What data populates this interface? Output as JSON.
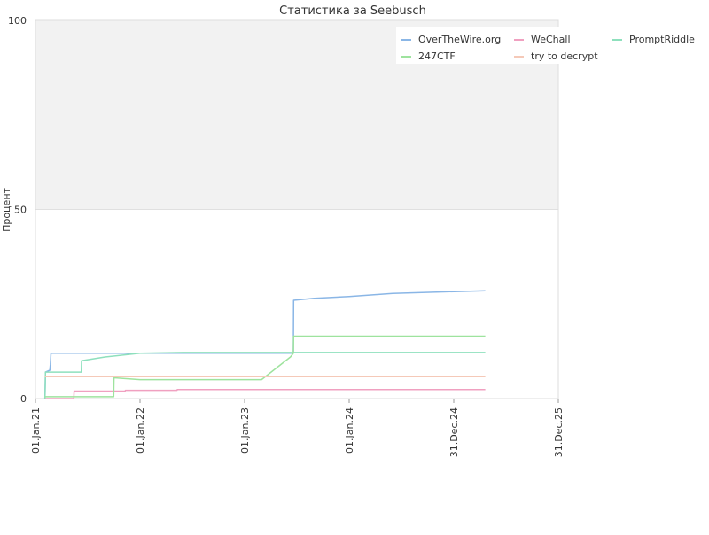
{
  "chart_data": {
    "type": "line",
    "title": "Статистика за Seebusch",
    "xlabel": "",
    "ylabel": "Процент",
    "xlim": [
      "2021-01-01",
      "2025-12-31"
    ],
    "ylim": [
      0,
      100
    ],
    "x_ticks": [
      "01.Jan.21",
      "01.Jan.22",
      "01.Jan.23",
      "01.Jan.24",
      "31.Dec.24",
      "31.Dec.25"
    ],
    "x_tick_dates": [
      "2021-01-01",
      "2022-01-01",
      "2023-01-01",
      "2024-01-01",
      "2024-12-31",
      "2025-12-31"
    ],
    "y_ticks": [
      "0",
      "50",
      "100"
    ],
    "y_tick_values": [
      0,
      50,
      100
    ],
    "grid": true,
    "band_color": "#f2f2f2",
    "legend_position": "top-right",
    "series": [
      {
        "name": "OverTheWire.org",
        "color": "#8ab6e6",
        "points": [
          [
            "2021-02-03",
            0
          ],
          [
            "2021-02-05",
            7
          ],
          [
            "2021-02-20",
            7.5
          ],
          [
            "2021-02-22",
            9
          ],
          [
            "2021-02-24",
            12
          ],
          [
            "2023-06-20",
            12
          ],
          [
            "2023-06-21",
            26
          ],
          [
            "2023-09-01",
            26.5
          ],
          [
            "2024-01-01",
            27
          ],
          [
            "2024-06-01",
            27.8
          ],
          [
            "2025-01-01",
            28.3
          ],
          [
            "2025-04-20",
            28.5
          ]
        ]
      },
      {
        "name": "WeChall",
        "color": "#f0a0c0",
        "points": [
          [
            "2021-02-03",
            0
          ],
          [
            "2021-05-15",
            0
          ],
          [
            "2021-05-16",
            2
          ],
          [
            "2021-11-10",
            2
          ],
          [
            "2021-11-11",
            2.2
          ],
          [
            "2022-05-10",
            2.2
          ],
          [
            "2022-05-11",
            2.4
          ],
          [
            "2025-04-20",
            2.4
          ]
        ]
      },
      {
        "name": "PromptRiddle",
        "color": "#8ee0bd",
        "points": [
          [
            "2021-02-03",
            0
          ],
          [
            "2021-02-05",
            7
          ],
          [
            "2021-06-10",
            7
          ],
          [
            "2021-06-11",
            10
          ],
          [
            "2021-09-01",
            11
          ],
          [
            "2022-01-01",
            12
          ],
          [
            "2022-06-01",
            12.2
          ],
          [
            "2025-04-20",
            12.2
          ]
        ]
      },
      {
        "name": "247CTF",
        "color": "#9ee39e",
        "points": [
          [
            "2021-02-03",
            0.5
          ],
          [
            "2021-10-01",
            0.5
          ],
          [
            "2021-10-02",
            5.5
          ],
          [
            "2022-01-01",
            5
          ],
          [
            "2023-03-01",
            5
          ],
          [
            "2023-06-10",
            11
          ],
          [
            "2023-06-20",
            12
          ],
          [
            "2023-06-21",
            16.5
          ],
          [
            "2025-04-20",
            16.5
          ]
        ]
      },
      {
        "name": "try to decrypt",
        "color": "#f5c9b8",
        "points": [
          [
            "2021-02-03",
            5.8
          ],
          [
            "2025-04-20",
            5.8
          ]
        ]
      }
    ]
  }
}
